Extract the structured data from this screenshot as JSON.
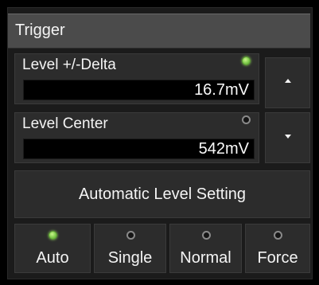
{
  "panel": {
    "title": "Trigger"
  },
  "level_delta": {
    "label": "Level +/-Delta",
    "value": "16.7mV",
    "indicator": "on"
  },
  "level_center": {
    "label": "Level Center",
    "value": "542mV",
    "indicator": "off"
  },
  "buttons": {
    "increase_icon": "triangle-up-icon",
    "decrease_icon": "triangle-down-icon",
    "automatic_level": "Automatic Level Setting"
  },
  "modes": [
    {
      "label": "Auto",
      "selected": true
    },
    {
      "label": "Single",
      "selected": false
    },
    {
      "label": "Normal",
      "selected": false
    },
    {
      "label": "Force",
      "selected": false
    }
  ],
  "colors": {
    "indicator_on": "#7dc94a",
    "indicator_off": "#8a8a8a",
    "header": "#4b4b4b",
    "panel": "#2c2c2c",
    "value_background": "#000000"
  }
}
